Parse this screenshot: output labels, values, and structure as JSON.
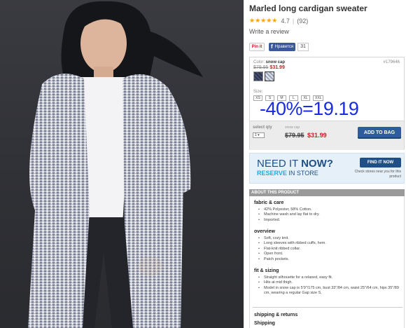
{
  "product": {
    "title": "Marled long cardigan sweater",
    "stars": "★★★★★",
    "rating": "4.7",
    "review_count": "(92)",
    "write_review": "Write a review"
  },
  "social": {
    "pin_label": "Pin it",
    "fb_icon": "f",
    "fb_label": "Нравится",
    "fb_count": "31"
  },
  "config": {
    "color_prefix": "Color: ",
    "color_name": "snow cap",
    "sku": "#179646",
    "was_price": "$79.95",
    "now_price": "$31.99",
    "size_label": "Size:",
    "sizes": [
      "XS",
      "S",
      "M",
      "L",
      "XL",
      "XXL"
    ],
    "discount_overlay": "-40%=19.19",
    "qty_label": "select qty",
    "qty_value": "1",
    "color_label2": "snow cap",
    "add_to_bag": "ADD TO BAG"
  },
  "need_it_now": {
    "line1_a": "NEED IT ",
    "line1_b": "NOW?",
    "line2_a": "RESERVE",
    "line2_b": " IN STORE",
    "button": "FIND IT NOW",
    "note": "Check stores near you for this product"
  },
  "about": {
    "header": "ABOUT THIS PRODUCT",
    "sections": [
      {
        "title": "fabric & care",
        "items": [
          "42% Polyester, 58% Cotton.",
          "Machine wash and lay flat to dry.",
          "Imported."
        ]
      },
      {
        "title": "overview",
        "items": [
          "Soft, cozy knit.",
          "Long sleeves with ribbed cuffs, hem.",
          "Flat-knit ribbed collar.",
          "Open front.",
          "Patch pockets."
        ]
      },
      {
        "title": "fit & sizing",
        "items": [
          "Straight silhouette for a relaxed, easy fit.",
          "Hits at mid thigh.",
          "Model in snow cap is 5'9\"/175 cm, bust 33\"/84 cm, waist 25\"/64 cm, hips 35\"/89 cm, wearing a regular Gap size S."
        ]
      }
    ],
    "shipping_title": "shipping & returns",
    "shipping_sub": "Shipping"
  },
  "colors": {
    "accent_blue": "#2f5d9c",
    "sale_red": "#d11b22",
    "overlay_blue": "#1a2ce0",
    "star_orange": "#f6a21a"
  }
}
